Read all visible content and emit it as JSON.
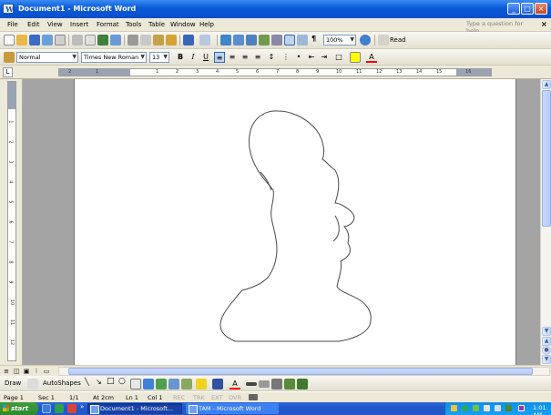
{
  "window": {
    "title": "Document1 - Microsoft Word",
    "app_icon": "W",
    "minimize": "_",
    "maximize": "□",
    "close": "×"
  },
  "menu": {
    "items": [
      "File",
      "Edit",
      "View",
      "Insert",
      "Format",
      "Tools",
      "Table",
      "Window",
      "Help"
    ],
    "ask_placeholder": "Type a question for help",
    "close_doc": "×"
  },
  "standard_toolbar": {
    "zoom": "100%",
    "read_label": "Read"
  },
  "formatting_toolbar": {
    "style": "Normal",
    "font": "Times New Roman",
    "size": "13",
    "bold": "B",
    "italic": "I",
    "underline": "U",
    "highlight_color": "#ffff00",
    "font_color": "#ff0000"
  },
  "ruler": {
    "marks": [
      "2",
      "1",
      "1",
      "2",
      "3",
      "4",
      "5",
      "6",
      "7",
      "8",
      "9",
      "10",
      "11",
      "12",
      "13",
      "14",
      "15",
      "16",
      "17",
      "18"
    ]
  },
  "vruler": {
    "marks": [
      "1",
      "2",
      "3",
      "4",
      "5",
      "6",
      "7",
      "8",
      "9",
      "10",
      "11",
      "12",
      "13"
    ]
  },
  "draw_toolbar": {
    "draw_label": "Draw",
    "autoshapes_label": "AutoShapes"
  },
  "status": {
    "page": "Page 1",
    "section": "Sec 1",
    "pages": "1/1",
    "at": "At 2cm",
    "line": "Ln 1",
    "col": "Col 1",
    "rec": "REC",
    "trk": "TRK",
    "ext": "EXT",
    "ovr": "OVR"
  },
  "taskbar": {
    "start": "start",
    "tasks": [
      "Document1 - Microsoft...",
      "TAM - Microsoft Word"
    ],
    "clock": "1:01 AM"
  },
  "colors": {
    "titlebar": "#0a5ad8",
    "taskbar": "#245edb",
    "start": "#3c9a3c",
    "tray": "#0f8ee9"
  }
}
